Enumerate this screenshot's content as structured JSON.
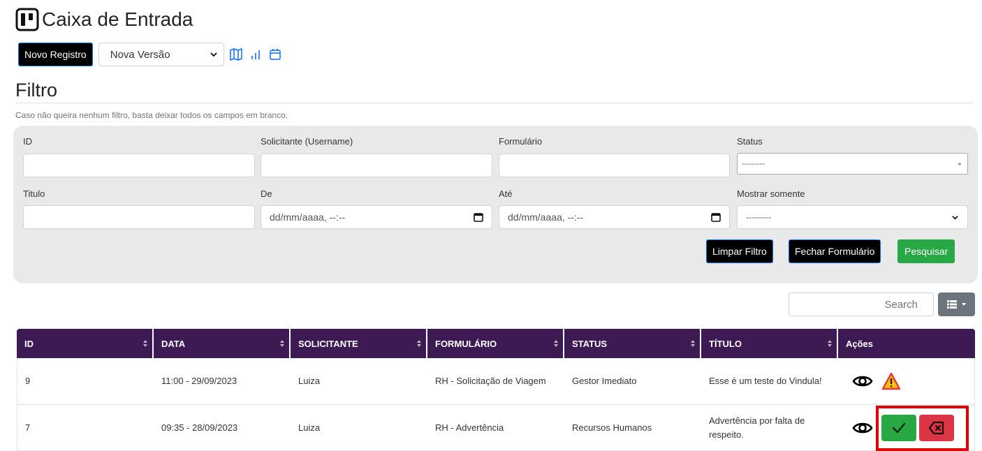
{
  "page": {
    "title": "Caixa de Entrada"
  },
  "toolbar": {
    "new_record_label": "Novo Registro",
    "version_select_value": "Nova Versão",
    "icons": [
      "map-icon",
      "bar-chart-icon",
      "calendar-icon"
    ]
  },
  "filter": {
    "title": "Filtro",
    "hint": "Caso não queira nenhum filtro, basta deixar todos os campos em branco.",
    "labels": {
      "id": "ID",
      "requester": "Solicitante (Username)",
      "form": "Formulário",
      "status": "Status",
      "title": "Titulo",
      "from": "De",
      "to": "Até",
      "show_only": "Mostrar somente"
    },
    "status_value": "---------",
    "show_only_value": "---------",
    "date_placeholder": "dd/mm/aaaa, --:--",
    "buttons": {
      "clear": "Limpar Filtro",
      "close": "Fechar Formulário",
      "search": "Pesquisar"
    }
  },
  "table_tools": {
    "search_placeholder": "Search"
  },
  "table": {
    "headers": [
      "ID",
      "DATA",
      "SOLICITANTE",
      "FORMULÁRIO",
      "STATUS",
      "TÍTULO",
      "Ações"
    ],
    "rows": [
      {
        "id": "9",
        "date": "11:00 - 29/09/2023",
        "requester": "Luiza",
        "form": "RH - Solicitação de Viagem",
        "status": "Gestor Imediato",
        "title": "Esse é um teste do Vindula!"
      },
      {
        "id": "7",
        "date": "09:35 - 28/09/2023",
        "requester": "Luiza",
        "form": "RH - Advertência",
        "status": "Recursos Humanos",
        "title": "Advertência por falta de respeito."
      }
    ]
  },
  "colors": {
    "header_bg": "#3e1a55",
    "success": "#28a745",
    "danger": "#dc3545",
    "highlight": "#e00000"
  }
}
